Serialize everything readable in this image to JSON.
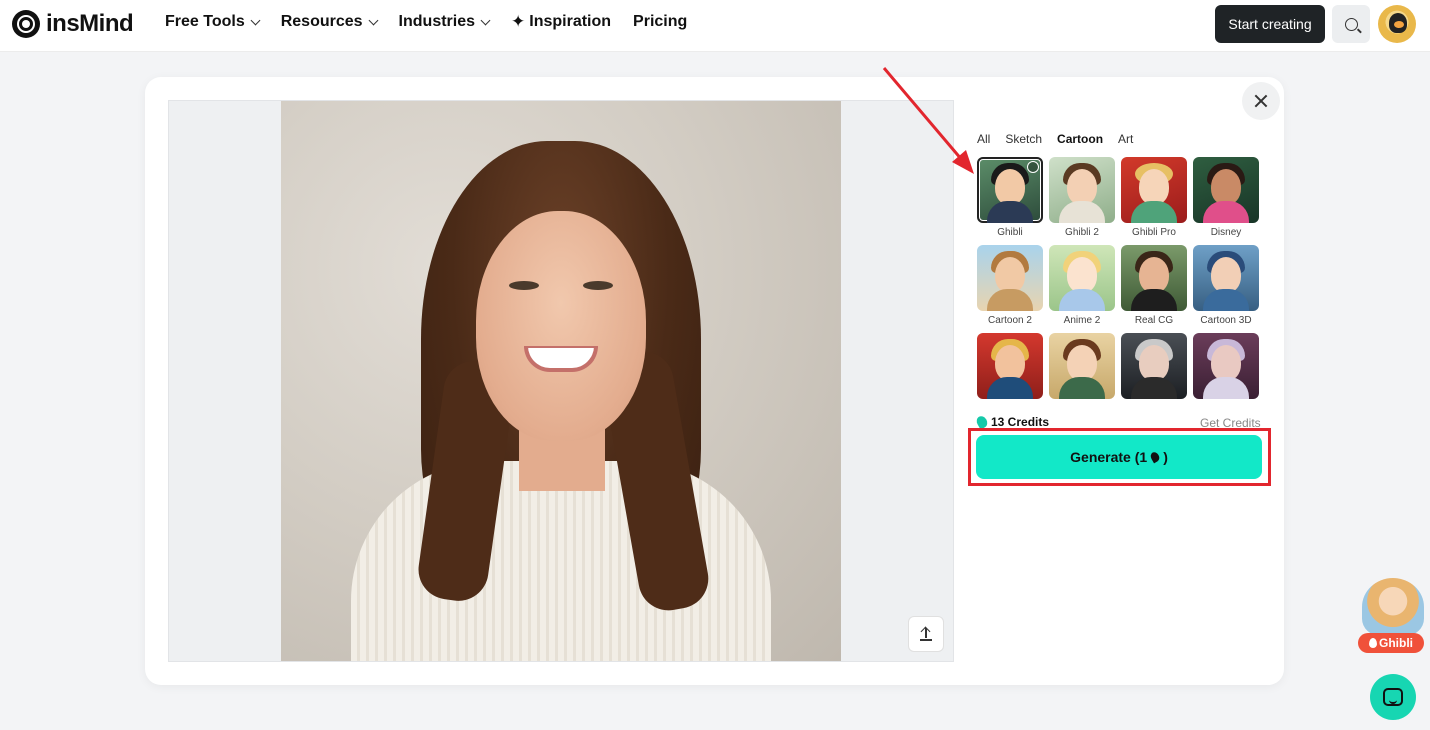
{
  "header": {
    "logo_text": "insMind",
    "nav": [
      {
        "label": "Free Tools",
        "dropdown": true
      },
      {
        "label": "Resources",
        "dropdown": true
      },
      {
        "label": "Industries",
        "dropdown": true
      },
      {
        "label": "Inspiration",
        "icon": "sparkle-icon"
      },
      {
        "label": "Pricing"
      }
    ],
    "start_label": "Start creating"
  },
  "panel": {
    "tabs": [
      "All",
      "Sketch",
      "Cartoon",
      "Art"
    ],
    "active_tab": "Cartoon",
    "styles": [
      {
        "label": "Ghibli",
        "selected": true
      },
      {
        "label": "Ghibli 2"
      },
      {
        "label": "Ghibli Pro"
      },
      {
        "label": "Disney"
      },
      {
        "label": "Cartoon 2"
      },
      {
        "label": "Anime 2"
      },
      {
        "label": "Real CG"
      },
      {
        "label": "Cartoon 3D"
      },
      {
        "label": ""
      },
      {
        "label": ""
      },
      {
        "label": ""
      },
      {
        "label": ""
      }
    ],
    "credits_label": "13 Credits",
    "get_credits_label": "Get Credits",
    "generate_label": "Generate (1",
    "generate_suffix": ")"
  },
  "floating": {
    "ghibli_label": "Ghibli"
  },
  "colors": {
    "accent": "#12e8c8",
    "highlight": "#e2262e",
    "start_button": "#1f2326"
  }
}
